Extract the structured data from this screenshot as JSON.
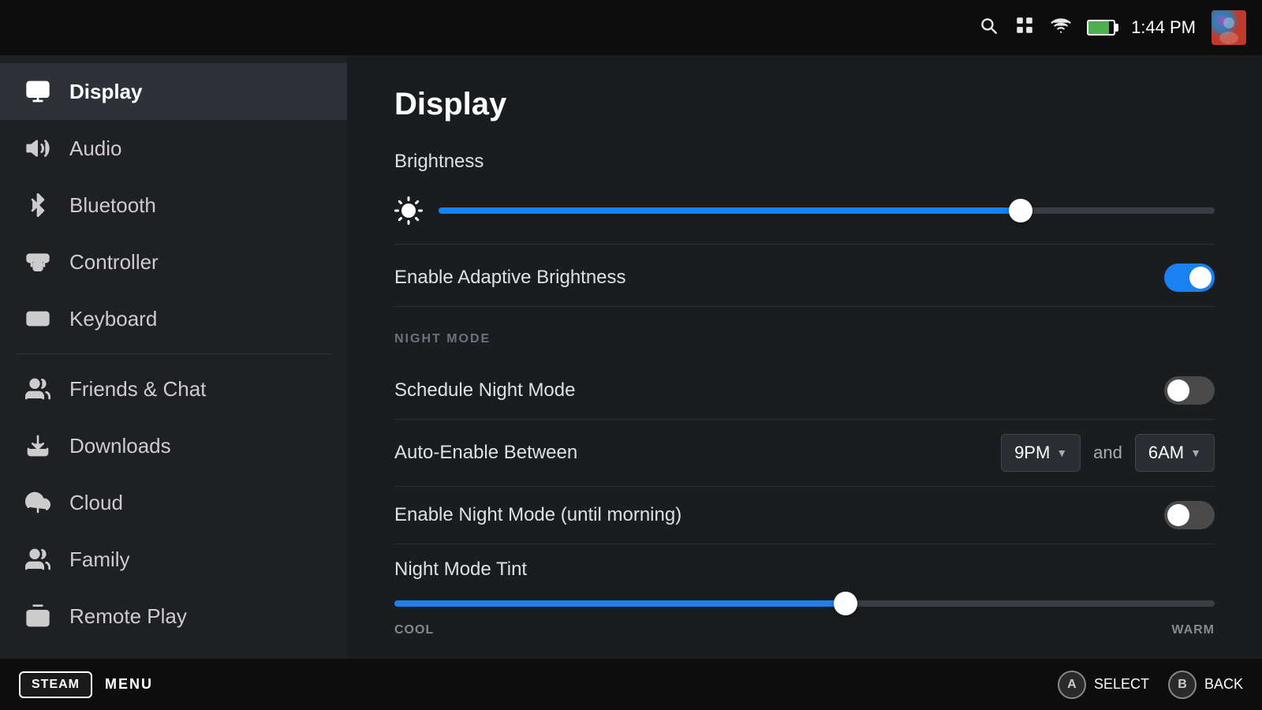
{
  "topbar": {
    "time": "1:44 PM",
    "icons": {
      "search": "🔍",
      "store": "▦",
      "cast": "📶",
      "battery": "battery"
    }
  },
  "bottombar": {
    "steam_label": "STEAM",
    "menu_label": "MENU",
    "select_label": "SELECT",
    "back_label": "BACK",
    "select_key": "A",
    "back_key": "B"
  },
  "sidebar": {
    "items": [
      {
        "id": "display",
        "label": "Display",
        "active": true
      },
      {
        "id": "audio",
        "label": "Audio",
        "active": false
      },
      {
        "id": "bluetooth",
        "label": "Bluetooth",
        "active": false
      },
      {
        "id": "controller",
        "label": "Controller",
        "active": false
      },
      {
        "id": "keyboard",
        "label": "Keyboard",
        "active": false
      },
      {
        "id": "friends",
        "label": "Friends & Chat",
        "active": false
      },
      {
        "id": "downloads",
        "label": "Downloads",
        "active": false
      },
      {
        "id": "cloud",
        "label": "Cloud",
        "active": false
      },
      {
        "id": "family",
        "label": "Family",
        "active": false
      },
      {
        "id": "remoteplay",
        "label": "Remote Play",
        "active": false
      }
    ]
  },
  "main": {
    "page_title": "Display",
    "brightness": {
      "label": "Brightness",
      "value": 75
    },
    "adaptive_brightness": {
      "label": "Enable Adaptive Brightness",
      "enabled": true
    },
    "night_mode_section": "NIGHT MODE",
    "schedule_night_mode": {
      "label": "Schedule Night Mode",
      "enabled": false
    },
    "auto_enable": {
      "label": "Auto-Enable Between",
      "from": "9PM",
      "to": "6AM",
      "and": "and"
    },
    "enable_night_mode": {
      "label": "Enable Night Mode (until morning)",
      "enabled": false
    },
    "night_mode_tint": {
      "label": "Night Mode Tint",
      "value": 55,
      "cool_label": "COOL",
      "warm_label": "WARM"
    }
  }
}
